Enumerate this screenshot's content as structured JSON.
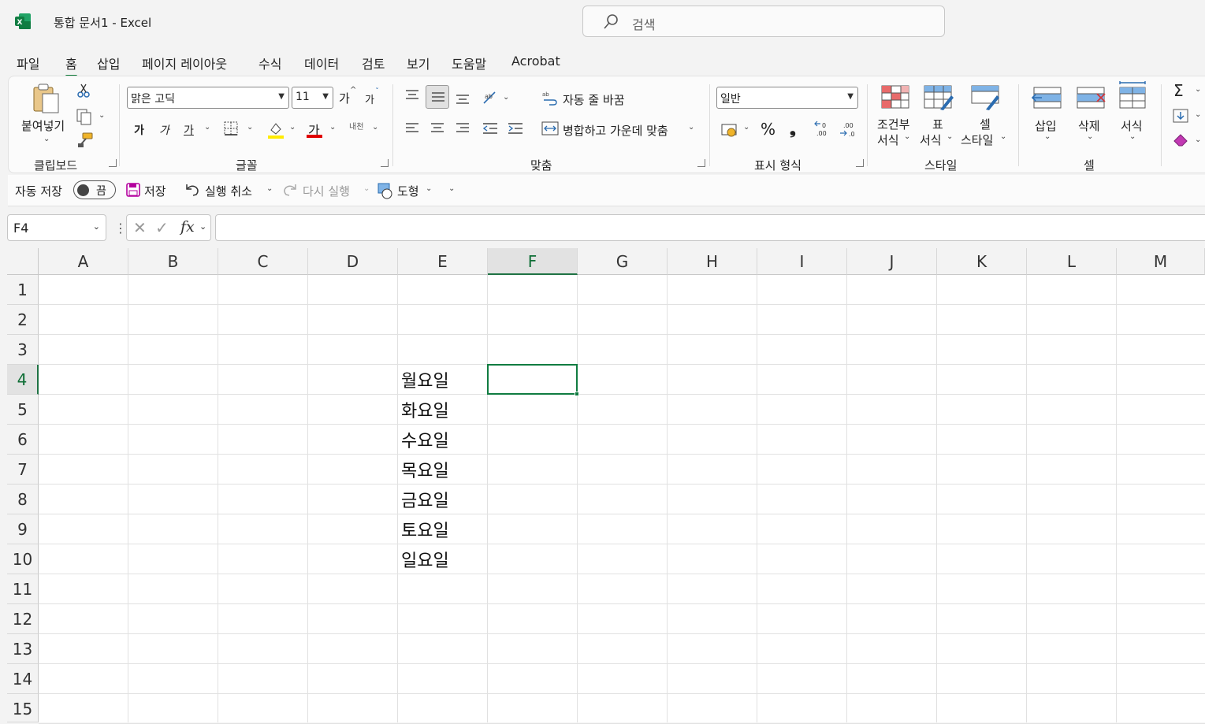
{
  "window": {
    "title": "통합 문서1  -  Excel",
    "search_placeholder": "검색",
    "accent": "#107c41"
  },
  "menu": {
    "tabs": [
      "파일",
      "홈",
      "삽입",
      "페이지 레이아웃",
      "수식",
      "데이터",
      "검토",
      "보기",
      "도움말",
      "Acrobat"
    ],
    "active": "홈"
  },
  "ribbon": {
    "clipboard": {
      "paste_label": "붙여넣기",
      "group_label": "클립보드"
    },
    "font": {
      "font_name": "맑은 고딕",
      "font_size": "11",
      "grow_label": "가",
      "shrink_label": "가",
      "bold_label": "가",
      "italic_label": "가",
      "underline_label": "가",
      "font_color_label": "가",
      "phonetic_label": "내천",
      "group_label": "글꼴"
    },
    "alignment": {
      "wrap_label": "자동 줄 바꿈",
      "merge_label": "병합하고 가운데 맞춤",
      "group_label": "맞춤"
    },
    "number": {
      "format": "일반",
      "percent": "%",
      "comma": "❟",
      "group_label": "표시 형식"
    },
    "styles": {
      "conditional_label_1": "조건부",
      "conditional_label_2": "서식",
      "table_label_1": "표",
      "table_label_2": "서식",
      "cell_style_label_1": "셀",
      "cell_style_label_2": "스타일",
      "group_label": "스타일"
    },
    "cells": {
      "insert_label": "삽입",
      "delete_label": "삭제",
      "format_label": "서식",
      "group_label": "셀"
    },
    "editing": {
      "sum_icon": "Σ"
    }
  },
  "qat": {
    "autosave_label": "자동 저장",
    "autosave_state": "끔",
    "save_label": "저장",
    "undo_label": "실행 취소",
    "redo_label": "다시 실행",
    "shapes_label": "도형"
  },
  "formula_bar": {
    "name_box": "F4",
    "formula": ""
  },
  "sheet": {
    "columns": [
      "A",
      "B",
      "C",
      "D",
      "E",
      "F",
      "G",
      "H",
      "I",
      "J",
      "K",
      "L",
      "M"
    ],
    "rows": [
      "1",
      "2",
      "3",
      "4",
      "5",
      "6",
      "7",
      "8",
      "9",
      "10",
      "11",
      "12",
      "13",
      "14",
      "15"
    ],
    "selected_column": "F",
    "selected_row": "4",
    "column_e_values": [
      "월요일",
      "화요일",
      "수요일",
      "목요일",
      "금요일",
      "토요일",
      "일요일"
    ]
  }
}
